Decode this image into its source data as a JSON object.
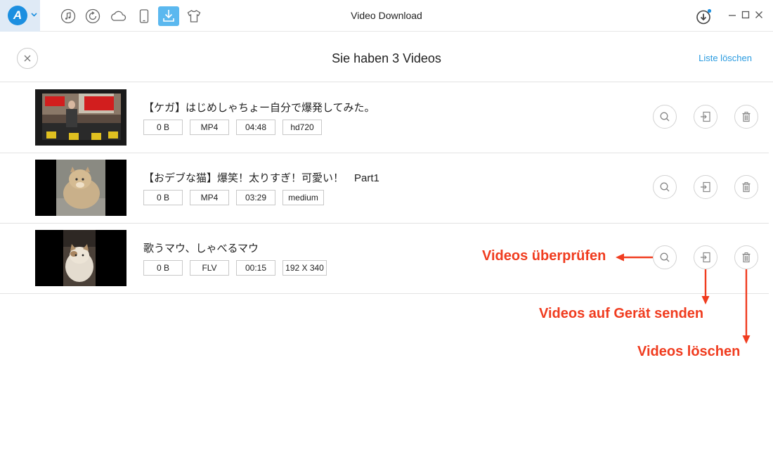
{
  "window": {
    "title": "Video Download"
  },
  "app": {
    "logo_letter": "A"
  },
  "toolbar": {
    "icons": [
      "music-icon",
      "restore-icon",
      "cloud-icon",
      "phone-icon",
      "download-icon",
      "tshirt-icon"
    ],
    "active": "download-icon"
  },
  "header": {
    "heading": "Sie haben 3 Videos",
    "clear_label": "Liste löschen"
  },
  "videos": [
    {
      "title": "【ケガ】はじめしゃちょー自分で爆発してみた。",
      "size": "0 B",
      "format": "MP4",
      "duration": "04:48",
      "quality": "hd720"
    },
    {
      "title": "【おデブな猫】爆笑！太りすぎ！可愛い！　Part1",
      "size": "0 B",
      "format": "MP4",
      "duration": "03:29",
      "quality": "medium"
    },
    {
      "title": "歌うマウ、しゃべるマウ",
      "size": "0 B",
      "format": "FLV",
      "duration": "00:15",
      "quality": "192 X 340"
    }
  ],
  "annotations": {
    "check": "Videos überprüfen",
    "send": "Videos auf Gerät senden",
    "delete": "Videos löschen"
  },
  "colors": {
    "accent": "#2a9be0",
    "annotation": "#f03c1f",
    "logo": "#1c8fe0"
  }
}
